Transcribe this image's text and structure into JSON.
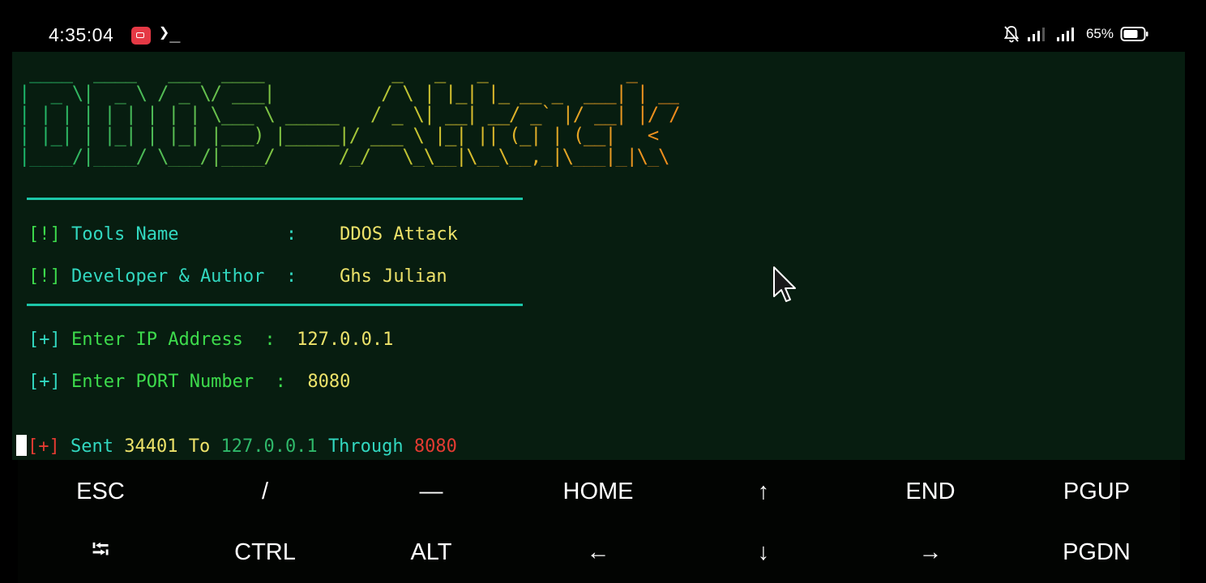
{
  "status_bar": {
    "time": "4:35:04",
    "battery": "65%"
  },
  "terminal": {
    "banner_ascii": " ____  ____   ___  ____            _   _   _             _    \n|  _ \\|  _ \\ / _ \\/ ___|          / \\ | |_| |_ __ _  ___| | __\n| | | | | | | | | \\___ \\ _____   / _ \\| __| __/ _` |/ __| |/ /\n| |_| | |_| | |_| |___) |_____|/ ___ \\ |_| || (_| | (__|   < \n|____/|____/ \\___/|____/      /_/   \\_\\__|\\__\\__,_|\\___|_|\\_\\",
    "info": [
      {
        "marker": "[!]",
        "label": "Tools Name          ",
        "sep": ":",
        "value": "DDOS Attack"
      },
      {
        "marker": "[!]",
        "label": "Developer & Author  ",
        "sep": ":",
        "value": "Ghs Julian"
      }
    ],
    "prompts": [
      {
        "marker": "[+]",
        "label": "Enter IP Address  ",
        "sep": ":",
        "value": "127.0.0.1"
      },
      {
        "marker": "[+]",
        "label": "Enter PORT Number  ",
        "sep": ":",
        "value": "8080"
      }
    ],
    "status_line": {
      "marker": "[+]",
      "sent_word": "Sent",
      "count": "34401",
      "to_word": "To",
      "ip": "127.0.0.1",
      "through_word": "Through",
      "port": "8080"
    }
  },
  "extra_keys": {
    "row1": [
      "ESC",
      "/",
      "—",
      "HOME",
      "↑",
      "END",
      "PGUP"
    ],
    "row2": [
      "⭾",
      "CTRL",
      "ALT",
      "←",
      "↓",
      "→",
      "PGDN"
    ]
  }
}
